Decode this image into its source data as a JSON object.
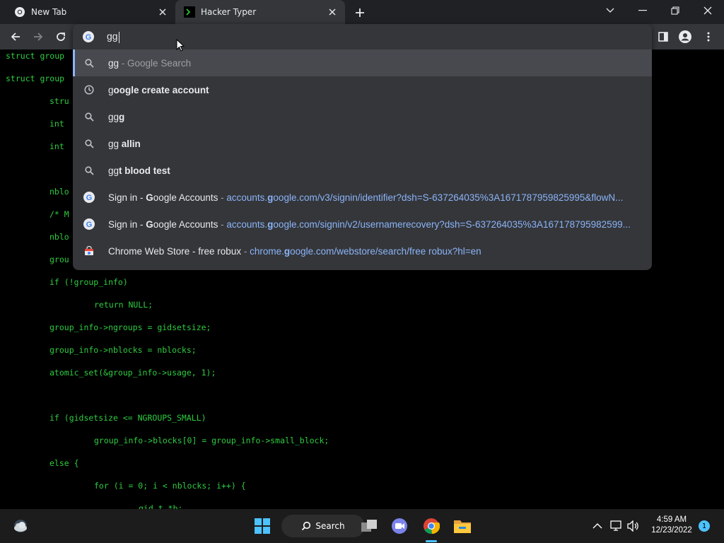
{
  "tabs": [
    {
      "label": "New Tab",
      "favicon": "chrome-icon",
      "active": false
    },
    {
      "label": "Hacker Typer",
      "favicon": "terminal-icon",
      "active": true
    }
  ],
  "omnibox": {
    "value": "gg",
    "suggestions": [
      {
        "type": "search",
        "icon": "search-icon",
        "prefix": "gg",
        "rest": "",
        "sep": " - ",
        "hint": "Google Search",
        "url": ""
      },
      {
        "type": "history",
        "icon": "clock-icon",
        "prefix": "g",
        "rest": "oogle create account",
        "sep": "",
        "hint": "",
        "url": ""
      },
      {
        "type": "search",
        "icon": "search-icon",
        "prefix": "gg",
        "rest": "g",
        "sep": "",
        "hint": "",
        "url": ""
      },
      {
        "type": "search",
        "icon": "search-icon",
        "prefix": "gg",
        "rest": " allin",
        "sep": "",
        "hint": "",
        "url": ""
      },
      {
        "type": "search",
        "icon": "search-icon",
        "prefix": "gg",
        "rest": "t blood test",
        "sep": "",
        "hint": "",
        "url": ""
      },
      {
        "type": "site",
        "icon": "google-icon",
        "title_a": "Sign in - ",
        "title_b": "G",
        "title_c": "oogle Accounts",
        "sep": " - ",
        "url_a": "accounts.",
        "url_b": "g",
        "url_c": "oogle.com/v3/signin/identifier?dsh=S-637264035%3A1671787959825995&flowN..."
      },
      {
        "type": "site",
        "icon": "google-icon",
        "title_a": "Sign in - ",
        "title_b": "G",
        "title_c": "oogle Accounts",
        "sep": " - ",
        "url_a": "accounts.",
        "url_b": "g",
        "url_c": "oogle.com/signin/v2/usernamerecovery?dsh=S-637264035%3A167178795982599..."
      },
      {
        "type": "site",
        "icon": "webstore-icon",
        "title_a": "Chrome Web Store - free robux",
        "title_b": "",
        "title_c": "",
        "sep": " - ",
        "url_a": "chrome.",
        "url_b": "g",
        "url_c": "oogle.com/webstore/search/free robux?hl=en"
      }
    ]
  },
  "code_lines": [
    "struct group",
    "struct group",
    "stru",
    "int",
    "int",
    "nblo",
    "/* M",
    "nblo",
    "grou",
    "if (!group_info)",
    "return NULL;",
    "group_info->ngroups = gidsetsize;",
    "group_info->nblocks = nblocks;",
    "atomic_set(&group_info->usage, 1);",
    "if (gidsetsize <= NGROUPS_SMALL)",
    "group_info->blocks[0] = group_info->small_block;",
    "else {",
    "for (i = 0; i < nblocks; i++) {",
    "gid_t *b;"
  ],
  "taskbar": {
    "search_label": "Search",
    "time": "4:59 AM",
    "date": "12/23/2022",
    "notification_count": "1"
  },
  "colors": {
    "code_green": "#2ecc40",
    "accent": "#4cc2ff",
    "link": "#8ab4f8"
  }
}
